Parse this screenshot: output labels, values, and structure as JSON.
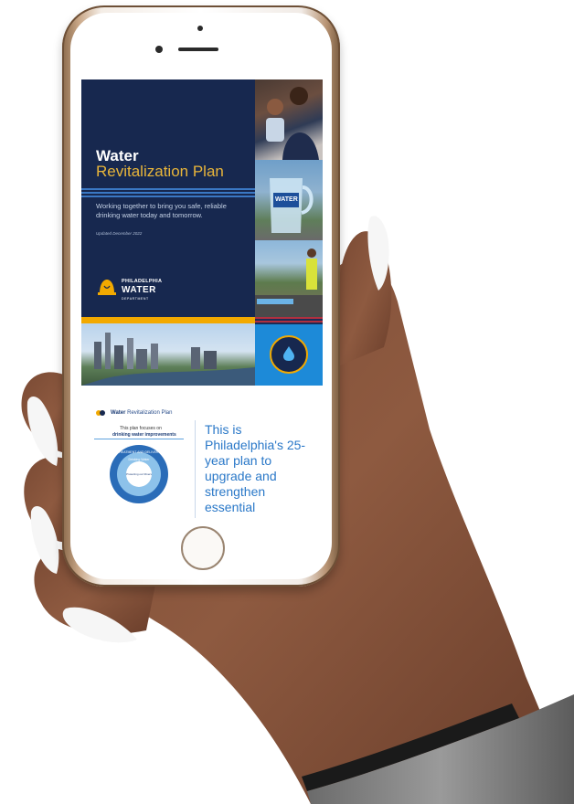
{
  "document": {
    "title_line1": "Water",
    "title_line2": "Revitalization Plan",
    "tagline": "Working together to bring you safe, reliable drinking water today and tomorrow.",
    "updated": "Updated December 2022",
    "logo": {
      "line1": "PHILADELPHIA",
      "line2": "WATER",
      "line3": "DEPARTMENT"
    },
    "photo_labels": {
      "pitcher_text": "WATER"
    }
  },
  "page_two": {
    "header_brand": "Water",
    "header_rest": "Revitalization Plan",
    "focus_line1": "This plan focuses on",
    "focus_line2": "drinking water improvements",
    "wheel_outer": "TREATMENT AND DELIVERY",
    "wheel_mid": "Drinking Water",
    "wheel_inner": "Protecting our Rivers",
    "big_text": "This is Philadelphia's 25-year plan to upgrade and strengthen essential"
  },
  "colors": {
    "navy": "#17284f",
    "gold": "#f2a900",
    "accent_blue": "#2a78c8",
    "drop_blue": "#1d8ad8"
  }
}
